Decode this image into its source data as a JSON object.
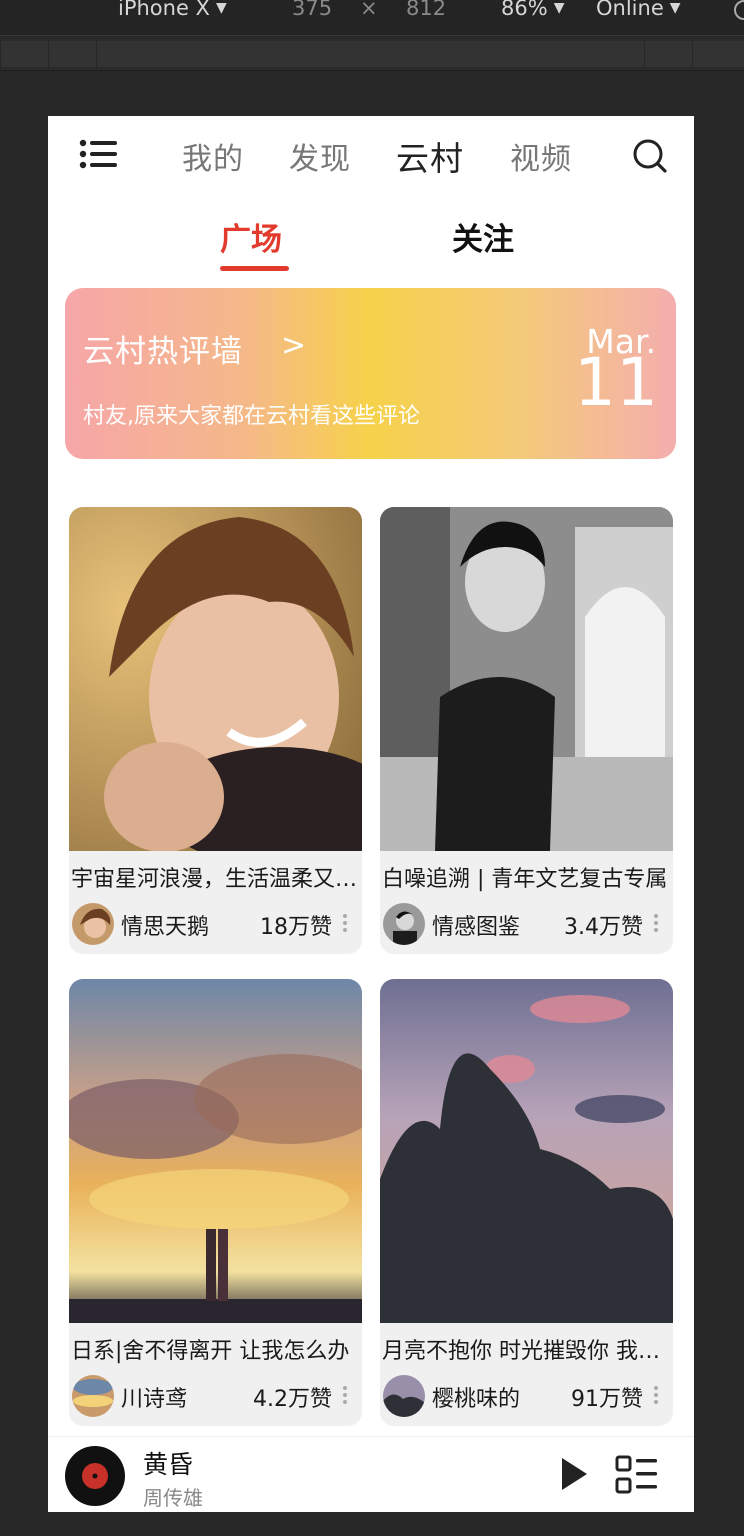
{
  "devtools": {
    "device": "iPhone X",
    "width": "375",
    "times": "×",
    "height": "812",
    "zoom": "86%",
    "network": "Online",
    "caret": "▼"
  },
  "nav": {
    "tabs": [
      "我的",
      "发现",
      "云村",
      "视频"
    ],
    "active_tab": "云村"
  },
  "subtabs": [
    "广场",
    "关注"
  ],
  "banner": {
    "title": "云村热评墙",
    "arrow": ">",
    "subtitle": "村友,原来大家都在云村看这些评论",
    "month": "Mar.",
    "day": "11"
  },
  "cards": [
    {
      "title": "宇宙星河浪漫，生活温柔又可爱",
      "author": "情思天鹅",
      "likes": "18万赞"
    },
    {
      "title": "白噪追溯 | 青年文艺复古专属",
      "author": "情感图鉴",
      "likes": "3.4万赞"
    },
    {
      "title": "日系|舍不得离开 让我怎么办",
      "author": "川诗鸢",
      "likes": "4.2万赞"
    },
    {
      "title": "月亮不抱你 时光摧毁你 我抱你",
      "author": "樱桃味的",
      "likes": "91万赞"
    }
  ],
  "player": {
    "song": "黄昏",
    "singer": "周传雄"
  },
  "colors": {
    "accent": "#e23a2c",
    "card_bg": "#f0f0f0"
  }
}
